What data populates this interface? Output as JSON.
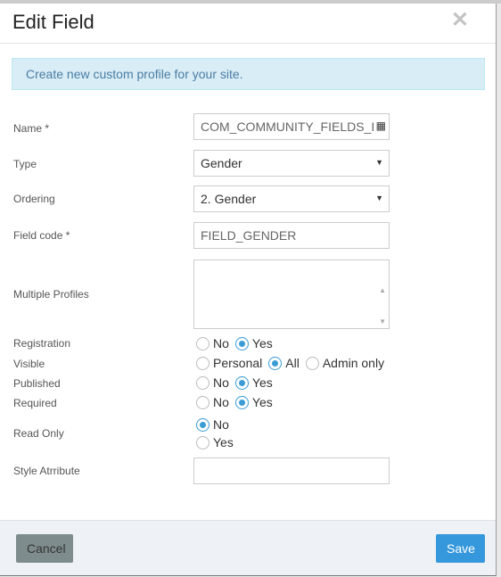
{
  "dialog": {
    "title": "Edit Field",
    "close_icon": "close-icon"
  },
  "alert": "Create new custom profile for your site.",
  "fields": {
    "name": {
      "label": "Name *",
      "value": "COM_COMMUNITY_FIELDS_I"
    },
    "type": {
      "label": "Type",
      "value": "Gender"
    },
    "ordering": {
      "label": "Ordering",
      "value": "2. Gender"
    },
    "code": {
      "label": "Field code *",
      "value": "FIELD_GENDER"
    },
    "profiles": {
      "label": "Multiple Profiles"
    },
    "registration": {
      "label": "Registration",
      "options": [
        "No",
        "Yes"
      ],
      "selected": "Yes"
    },
    "visible": {
      "label": "Visible",
      "options": [
        "Personal",
        "All",
        "Admin only"
      ],
      "selected": "All"
    },
    "published": {
      "label": "Published",
      "options": [
        "No",
        "Yes"
      ],
      "selected": "Yes"
    },
    "required": {
      "label": "Required",
      "options": [
        "No",
        "Yes"
      ],
      "selected": "Yes"
    },
    "readonly": {
      "label": "Read Only",
      "options": [
        "No",
        "Yes"
      ],
      "selected": "No"
    },
    "style": {
      "label": "Style Atrribute",
      "value": ""
    }
  },
  "footer": {
    "cancel": "Cancel",
    "save": "Save"
  }
}
